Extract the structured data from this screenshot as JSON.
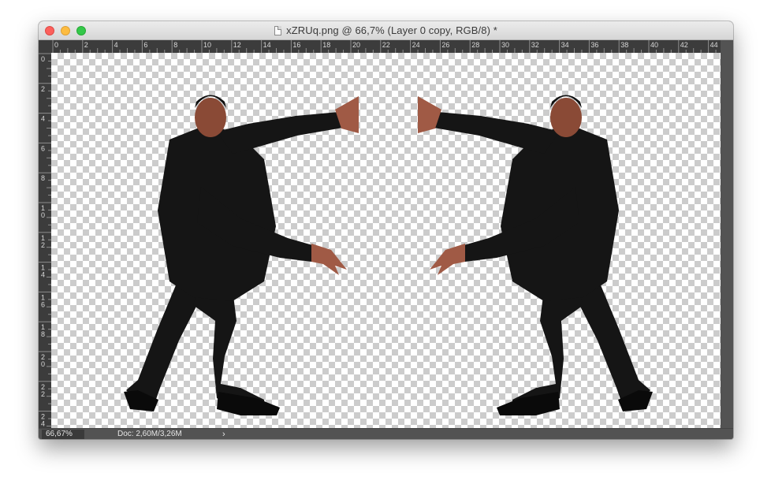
{
  "window": {
    "title": "xZRUq.png @ 66,7% (Layer 0 copy, RGB/8) *"
  },
  "rulers": {
    "horizontal_ticks": [
      "0",
      "2",
      "4",
      "6",
      "8",
      "10",
      "12",
      "14",
      "16",
      "18",
      "20",
      "22",
      "24",
      "26",
      "28",
      "30",
      "32",
      "34",
      "36",
      "38",
      "40",
      "42",
      "44"
    ],
    "vertical_ticks": [
      "0",
      "2",
      "4",
      "6",
      "8",
      "10",
      "12",
      "14",
      "16",
      "18",
      "20",
      "22",
      "24"
    ]
  },
  "canvas": {
    "layers": [
      "person-left",
      "person-right"
    ],
    "suit_color": "#151515",
    "skin_color": "#8a4a36",
    "checker_color": "#cccccc"
  },
  "statusbar": {
    "zoom": "66,67%",
    "doc_info": "Doc: 2,60M/3,26M",
    "menu_arrow": "›"
  },
  "icons": {
    "document": "document-icon",
    "close": "close-icon",
    "minimize": "minimize-icon",
    "zoom": "zoom-icon"
  }
}
